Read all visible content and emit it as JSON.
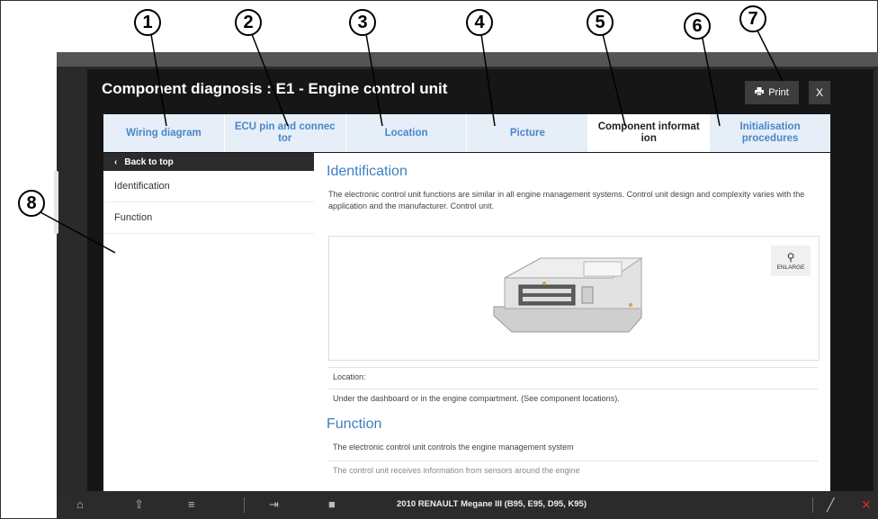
{
  "dialog": {
    "title": "Component diagnosis : E1 - Engine control unit",
    "print_label": "Print",
    "close_label": "X"
  },
  "tabs": [
    {
      "label": "Wiring diagram"
    },
    {
      "label": "ECU pin and connec tor"
    },
    {
      "label": "Location"
    },
    {
      "label": "Picture"
    },
    {
      "label": "Component informat ion"
    },
    {
      "label": "Initialisation procedures"
    }
  ],
  "sidebar": {
    "back_label": "Back to top",
    "items": [
      {
        "label": "Identification"
      },
      {
        "label": "Function"
      }
    ]
  },
  "content": {
    "identification_title": "Identification",
    "identification_text": "The electronic control unit functions are similar in all engine management systems. Control unit design and complexity varies with the application and the manufacturer. Control unit.",
    "enlarge_label": "ENLARGE",
    "location_label": "Location:",
    "location_text": "Under the dashboard or in the engine compartment. (See component locations).",
    "function_title": "Function",
    "function_text": "The electronic control unit controls the engine management system",
    "function_text_2": "The control unit receives information from sensors around the engine"
  },
  "bottombar": {
    "vehicle_text": "2010 RENAULT Megane III (B95, E95, D95, K95)"
  },
  "callouts": [
    "1",
    "2",
    "3",
    "4",
    "5",
    "6",
    "7",
    "8"
  ],
  "icons": {
    "back": "chevron-left-icon",
    "print": "printer-icon",
    "enlarge": "magnifier-icon"
  }
}
